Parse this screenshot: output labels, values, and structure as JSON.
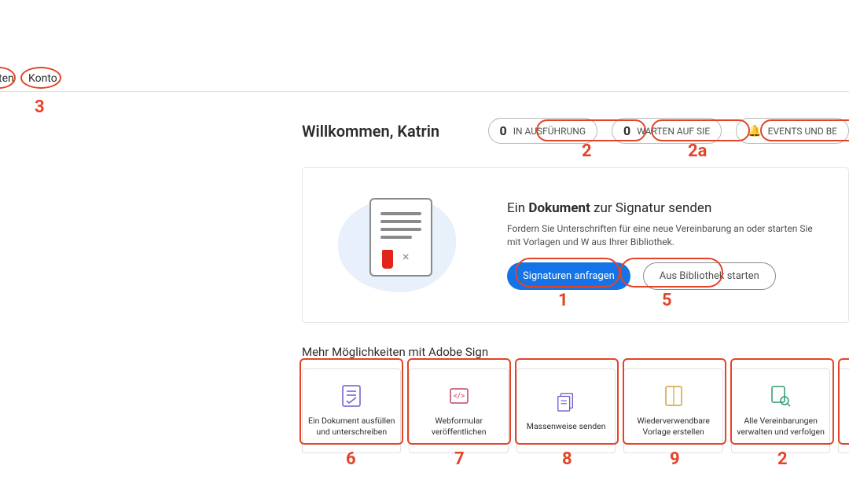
{
  "nav": {
    "item1": "ten",
    "item2": "Konto"
  },
  "welcome_prefix": "Willkommen",
  "welcome_name": "Katrin",
  "pills": {
    "in_progress": {
      "count": "0",
      "label": "IN AUSFÜHRUNG"
    },
    "waiting": {
      "count": "0",
      "label": "WARTEN AUF SIE"
    },
    "events": {
      "label": "EVENTS UND BE"
    }
  },
  "hero": {
    "title_pre": "Ein ",
    "title_bold": "Dokument",
    "title_post": " zur Signatur senden",
    "desc": "Fordern Sie Unterschriften für eine neue Vereinbarung an oder starten Sie mit Vorlagen und W aus Ihrer Bibliothek.",
    "primary": "Signaturen anfragen",
    "secondary": "Aus Bibliothek starten"
  },
  "more_title": "Mehr Möglichkeiten mit Adobe Sign",
  "cards": [
    {
      "label": "Ein Dokument ausfüllen und unterschreiben"
    },
    {
      "label": "Webformular veröffentlichen"
    },
    {
      "label": "Massenweise senden"
    },
    {
      "label": "Wiederverwendbare Vorlage erstellen"
    },
    {
      "label": "Alle Vereinbarungen verwalten und verfolgen"
    }
  ],
  "annotations": {
    "a1": "1",
    "a2": "2",
    "a2a": "2a",
    "a3": "3",
    "a5": "5",
    "a6": "6",
    "a7": "7",
    "a8": "8",
    "a9": "9",
    "a2b": "2"
  }
}
